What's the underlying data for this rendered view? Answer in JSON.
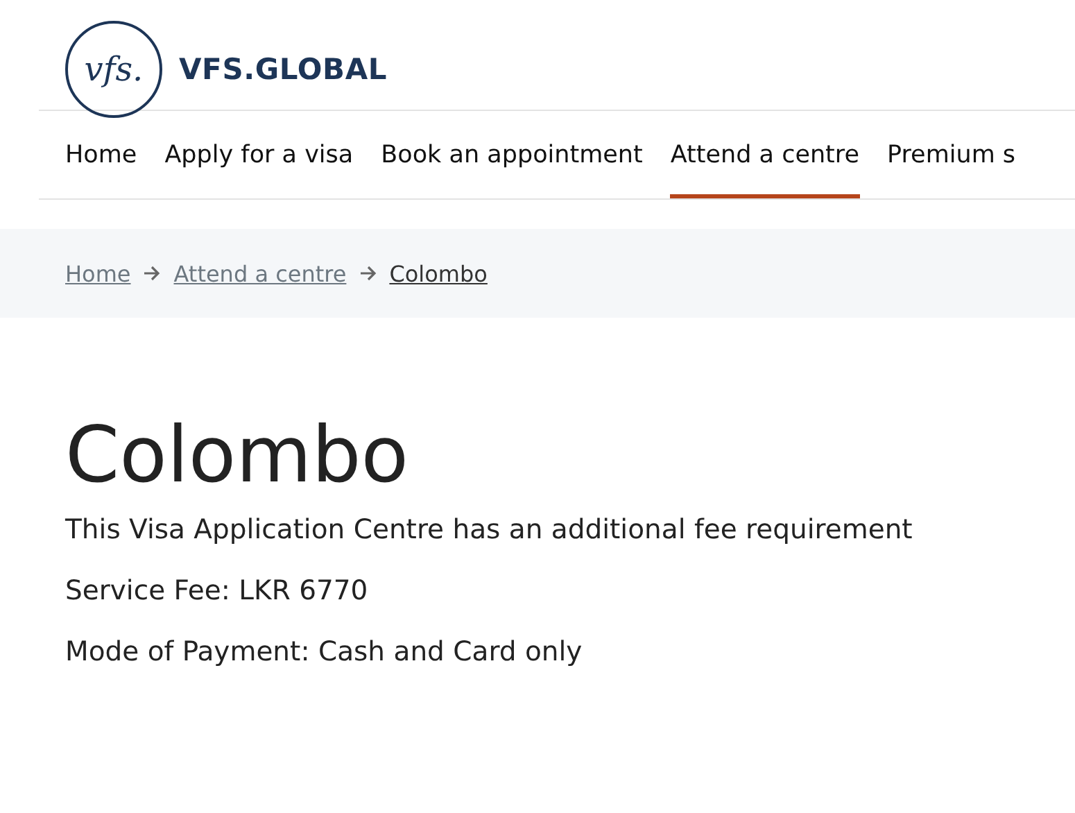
{
  "logo": {
    "mark": "vfs.",
    "wordmark": "VFS.GLOBAL"
  },
  "nav": [
    {
      "label": "Home",
      "selected": false
    },
    {
      "label": "Apply for a visa",
      "selected": false
    },
    {
      "label": "Book an appointment",
      "selected": false
    },
    {
      "label": "Attend a centre",
      "selected": true
    },
    {
      "label": "Premium s",
      "selected": false
    }
  ],
  "breadcrumb": [
    {
      "label": "Home",
      "current": false
    },
    {
      "label": "Attend a centre",
      "current": false
    },
    {
      "label": "Colombo",
      "current": true
    }
  ],
  "title": "Colombo",
  "details": [
    "This Visa Application Centre has an additional fee requirement",
    "Service Fee: LKR 6770",
    "Mode of Payment: Cash and Card only"
  ]
}
